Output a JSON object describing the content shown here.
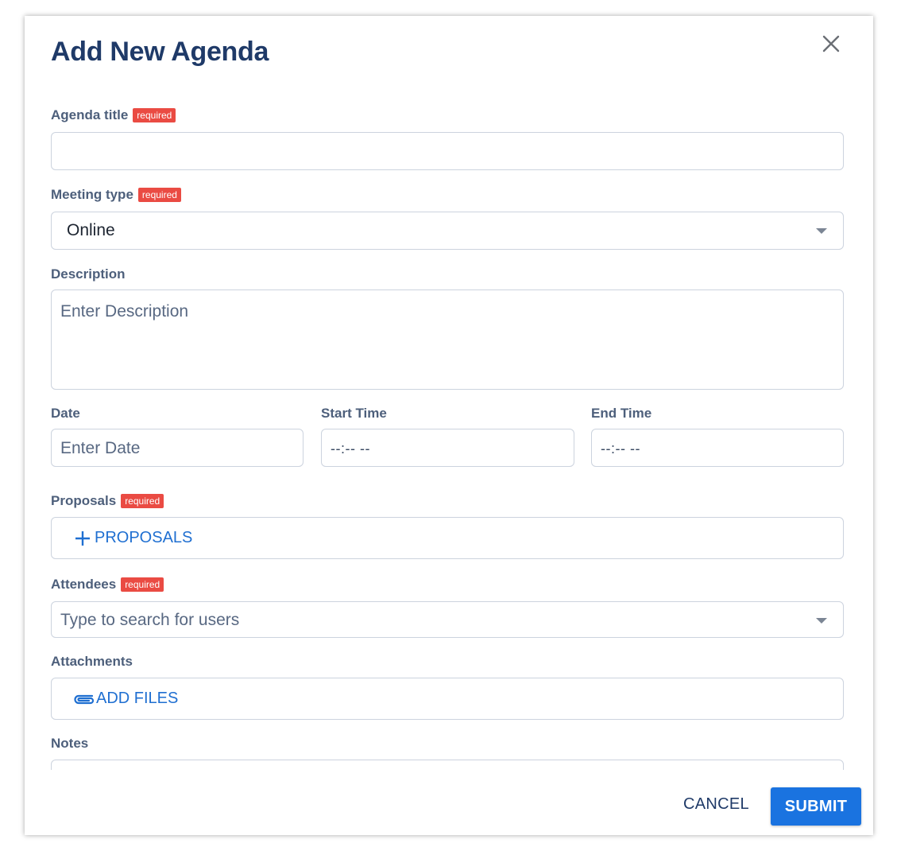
{
  "dialog": {
    "title": "Add New Agenda",
    "close_icon": "close-icon"
  },
  "required_badge": "required",
  "fields": {
    "agenda_title": {
      "label": "Agenda title",
      "value": ""
    },
    "meeting_type": {
      "label": "Meeting type",
      "value": "Online"
    },
    "description": {
      "label": "Description",
      "placeholder": "Enter Description"
    },
    "date": {
      "label": "Date",
      "placeholder": "Enter Date"
    },
    "start_time": {
      "label": "Start Time",
      "value": "--:-- --"
    },
    "end_time": {
      "label": "End Time",
      "value": "--:-- --"
    },
    "proposals": {
      "label": "Proposals",
      "action": "PROPOSALS",
      "icon": "plus-icon"
    },
    "attendees": {
      "label": "Attendees",
      "placeholder": "Type to search for users"
    },
    "attachments": {
      "label": "Attachments",
      "action": "ADD FILES",
      "icon": "paperclip-icon"
    },
    "notes": {
      "label": "Notes"
    }
  },
  "footer": {
    "cancel": "CANCEL",
    "submit": "SUBMIT"
  },
  "colors": {
    "title": "#1f3a68",
    "required_badge": "#ea4b43",
    "link": "#1f6fd1",
    "submit": "#1a73e0"
  }
}
